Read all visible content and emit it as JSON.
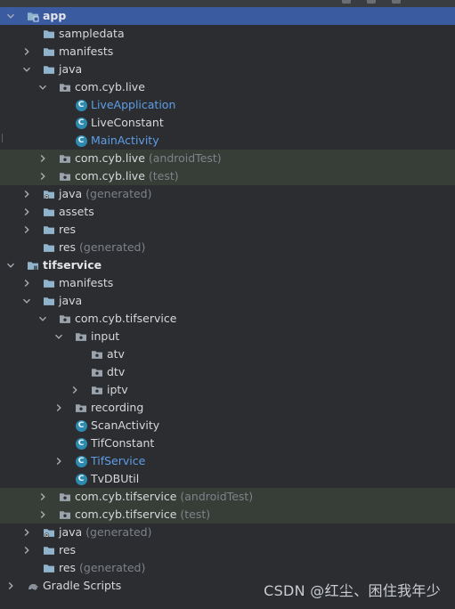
{
  "tree": [
    {
      "label": "app",
      "suffix": "",
      "indent": 0,
      "chevron": "down",
      "icon": "module-folder",
      "style": "bold",
      "row": "selected"
    },
    {
      "label": "sampledata",
      "suffix": "",
      "indent": 1,
      "chevron": "none",
      "icon": "folder",
      "style": "",
      "row": ""
    },
    {
      "label": "manifests",
      "suffix": "",
      "indent": 1,
      "chevron": "right",
      "icon": "folder",
      "style": "",
      "row": ""
    },
    {
      "label": "java",
      "suffix": "",
      "indent": 1,
      "chevron": "down",
      "icon": "folder",
      "style": "",
      "row": ""
    },
    {
      "label": "com.cyb.live",
      "suffix": "",
      "indent": 2,
      "chevron": "down",
      "icon": "package",
      "style": "",
      "row": ""
    },
    {
      "label": "LiveApplication",
      "suffix": "",
      "indent": 3,
      "chevron": "none",
      "icon": "class",
      "style": "blue",
      "row": ""
    },
    {
      "label": "LiveConstant",
      "suffix": "",
      "indent": 3,
      "chevron": "none",
      "icon": "class",
      "style": "",
      "row": ""
    },
    {
      "label": "MainActivity",
      "suffix": "",
      "indent": 3,
      "chevron": "none",
      "icon": "class",
      "style": "blue",
      "row": ""
    },
    {
      "label": "com.cyb.live",
      "suffix": " (androidTest)",
      "indent": 2,
      "chevron": "right",
      "icon": "package",
      "style": "",
      "row": "group-hl"
    },
    {
      "label": "com.cyb.live",
      "suffix": " (test)",
      "indent": 2,
      "chevron": "right",
      "icon": "package",
      "style": "",
      "row": "group-hl"
    },
    {
      "label": "java",
      "suffix": " (generated)",
      "indent": 1,
      "chevron": "right",
      "icon": "generated-folder",
      "style": "",
      "row": ""
    },
    {
      "label": "assets",
      "suffix": "",
      "indent": 1,
      "chevron": "right",
      "icon": "folder",
      "style": "",
      "row": ""
    },
    {
      "label": "res",
      "suffix": "",
      "indent": 1,
      "chevron": "right",
      "icon": "folder",
      "style": "",
      "row": ""
    },
    {
      "label": "res",
      "suffix": " (generated)",
      "indent": 1,
      "chevron": "none",
      "icon": "folder",
      "style": "",
      "row": ""
    },
    {
      "label": "tifservice",
      "suffix": "",
      "indent": 0,
      "chevron": "down",
      "icon": "library-module",
      "style": "bold",
      "row": ""
    },
    {
      "label": "manifests",
      "suffix": "",
      "indent": 1,
      "chevron": "right",
      "icon": "folder",
      "style": "",
      "row": ""
    },
    {
      "label": "java",
      "suffix": "",
      "indent": 1,
      "chevron": "down",
      "icon": "folder",
      "style": "",
      "row": ""
    },
    {
      "label": "com.cyb.tifservice",
      "suffix": "",
      "indent": 2,
      "chevron": "down",
      "icon": "package",
      "style": "",
      "row": ""
    },
    {
      "label": "input",
      "suffix": "",
      "indent": 3,
      "chevron": "down",
      "icon": "package",
      "style": "",
      "row": ""
    },
    {
      "label": "atv",
      "suffix": "",
      "indent": 4,
      "chevron": "none",
      "icon": "package",
      "style": "",
      "row": ""
    },
    {
      "label": "dtv",
      "suffix": "",
      "indent": 4,
      "chevron": "none",
      "icon": "package",
      "style": "",
      "row": ""
    },
    {
      "label": "iptv",
      "suffix": "",
      "indent": 4,
      "chevron": "right",
      "icon": "package",
      "style": "",
      "row": ""
    },
    {
      "label": "recording",
      "suffix": "",
      "indent": 3,
      "chevron": "right",
      "icon": "package",
      "style": "",
      "row": ""
    },
    {
      "label": "ScanActivity",
      "suffix": "",
      "indent": 3,
      "chevron": "none",
      "icon": "class",
      "style": "",
      "row": ""
    },
    {
      "label": "TifConstant",
      "suffix": "",
      "indent": 3,
      "chevron": "none",
      "icon": "class",
      "style": "",
      "row": ""
    },
    {
      "label": "TifService",
      "suffix": "",
      "indent": 3,
      "chevron": "right",
      "icon": "class",
      "style": "blue",
      "row": ""
    },
    {
      "label": "TvDBUtil",
      "suffix": "",
      "indent": 3,
      "chevron": "none",
      "icon": "class",
      "style": "",
      "row": ""
    },
    {
      "label": "com.cyb.tifservice",
      "suffix": " (androidTest)",
      "indent": 2,
      "chevron": "right",
      "icon": "package",
      "style": "",
      "row": "group-hl"
    },
    {
      "label": "com.cyb.tifservice",
      "suffix": " (test)",
      "indent": 2,
      "chevron": "right",
      "icon": "package",
      "style": "",
      "row": "group-hl"
    },
    {
      "label": "java",
      "suffix": " (generated)",
      "indent": 1,
      "chevron": "right",
      "icon": "generated-folder",
      "style": "",
      "row": ""
    },
    {
      "label": "res",
      "suffix": "",
      "indent": 1,
      "chevron": "right",
      "icon": "folder",
      "style": "",
      "row": ""
    },
    {
      "label": "res",
      "suffix": " (generated)",
      "indent": 1,
      "chevron": "none",
      "icon": "folder",
      "style": "",
      "row": ""
    },
    {
      "label": "Gradle Scripts",
      "suffix": "",
      "indent": 0,
      "chevron": "right",
      "icon": "gradle",
      "style": "",
      "row": ""
    }
  ],
  "class_icon_letter": "C",
  "watermark": "CSDN @红尘、困住我年少",
  "colors": {
    "background": "#2b2d30",
    "selected_row": "#3a5ba0",
    "highlighted_group": "#373d37",
    "blue_label": "#5e9ee8",
    "folder_icon": "#8fb4cc",
    "class_icon": "#2f8ab0"
  }
}
